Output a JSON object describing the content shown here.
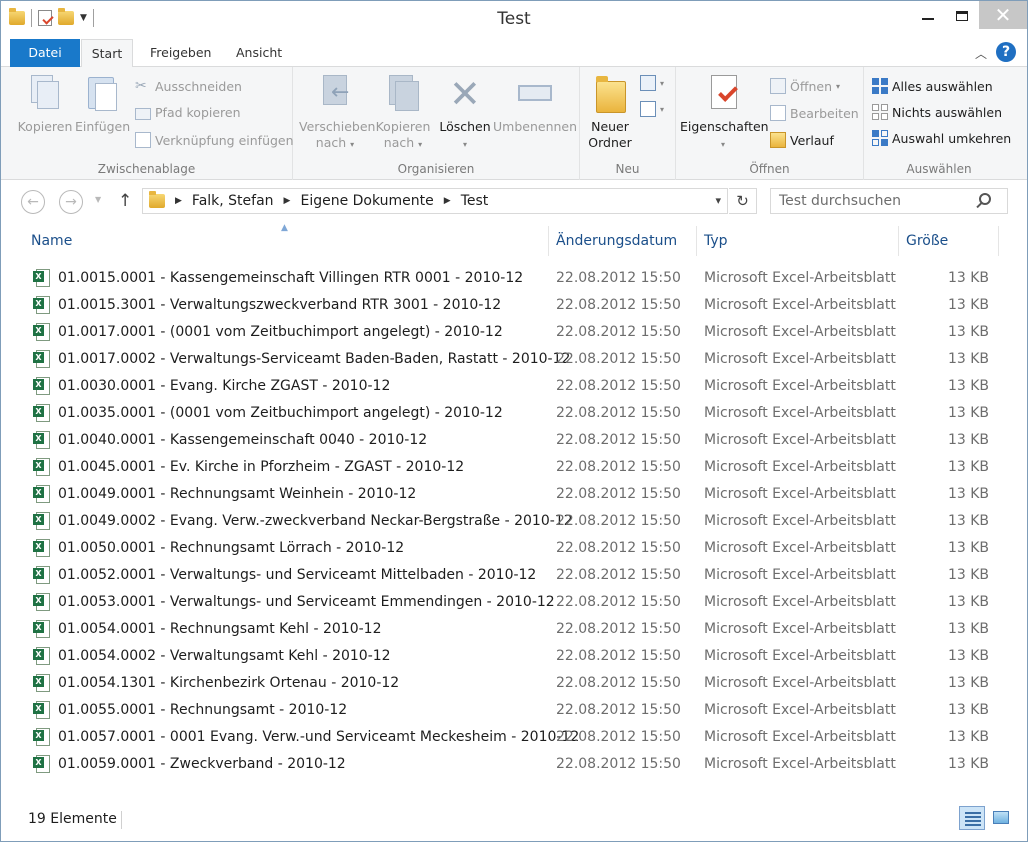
{
  "window": {
    "title": "Test"
  },
  "ribbon_tabs": [
    {
      "label": "Datei"
    },
    {
      "label": "Start"
    },
    {
      "label": "Freigeben"
    },
    {
      "label": "Ansicht"
    }
  ],
  "ribbon": {
    "clipboard": {
      "label": "Zwischenablage",
      "copy": "Kopieren",
      "paste": "Einfügen",
      "cut": "Ausschneiden",
      "copy_path": "Pfad kopieren",
      "paste_shortcut": "Verknüpfung einfügen"
    },
    "organize": {
      "label": "Organisieren",
      "move_to_1": "Verschieben",
      "move_to_2": "nach",
      "copy_to_1": "Kopieren",
      "copy_to_2": "nach",
      "delete": "Löschen",
      "rename": "Umbenennen"
    },
    "new": {
      "label": "Neu",
      "new_folder_1": "Neuer",
      "new_folder_2": "Ordner"
    },
    "open": {
      "label": "Öffnen",
      "properties": "Eigenschaften",
      "open": "Öffnen",
      "edit": "Bearbeiten",
      "history": "Verlauf"
    },
    "select": {
      "label": "Auswählen",
      "select_all": "Alles auswählen",
      "select_none": "Nichts auswählen",
      "invert": "Auswahl umkehren"
    }
  },
  "address": {
    "crumbs": [
      "Falk, Stefan",
      "Eigene Dokumente",
      "Test"
    ],
    "search_placeholder": "Test durchsuchen"
  },
  "columns": {
    "name": "Name",
    "date": "Änderungsdatum",
    "type": "Typ",
    "size": "Größe"
  },
  "files": [
    {
      "name": "01.0015.0001 - Kassengemeinschaft Villingen RTR 0001 - 2010-12",
      "date": "22.08.2012 15:50",
      "type": "Microsoft Excel-Arbeitsblatt",
      "size": "13 KB"
    },
    {
      "name": "01.0015.3001 - Verwaltungszweckverband RTR 3001 - 2010-12",
      "date": "22.08.2012 15:50",
      "type": "Microsoft Excel-Arbeitsblatt",
      "size": "13 KB"
    },
    {
      "name": "01.0017.0001 - (0001 vom Zeitbuchimport angelegt) - 2010-12",
      "date": "22.08.2012 15:50",
      "type": "Microsoft Excel-Arbeitsblatt",
      "size": "13 KB"
    },
    {
      "name": "01.0017.0002 - Verwaltungs-Serviceamt Baden-Baden, Rastatt - 2010-12",
      "date": "22.08.2012 15:50",
      "type": "Microsoft Excel-Arbeitsblatt",
      "size": "13 KB"
    },
    {
      "name": "01.0030.0001 - Evang. Kirche ZGAST - 2010-12",
      "date": "22.08.2012 15:50",
      "type": "Microsoft Excel-Arbeitsblatt",
      "size": "13 KB"
    },
    {
      "name": "01.0035.0001 - (0001 vom Zeitbuchimport angelegt) - 2010-12",
      "date": "22.08.2012 15:50",
      "type": "Microsoft Excel-Arbeitsblatt",
      "size": "13 KB"
    },
    {
      "name": "01.0040.0001 - Kassengemeinschaft 0040 - 2010-12",
      "date": "22.08.2012 15:50",
      "type": "Microsoft Excel-Arbeitsblatt",
      "size": "13 KB"
    },
    {
      "name": "01.0045.0001 - Ev. Kirche in Pforzheim - ZGAST - 2010-12",
      "date": "22.08.2012 15:50",
      "type": "Microsoft Excel-Arbeitsblatt",
      "size": "13 KB"
    },
    {
      "name": "01.0049.0001 - Rechnungsamt Weinhein - 2010-12",
      "date": "22.08.2012 15:50",
      "type": "Microsoft Excel-Arbeitsblatt",
      "size": "13 KB"
    },
    {
      "name": "01.0049.0002 - Evang. Verw.-zweckverband Neckar-Bergstraße - 2010-12",
      "date": "22.08.2012 15:50",
      "type": "Microsoft Excel-Arbeitsblatt",
      "size": "13 KB"
    },
    {
      "name": "01.0050.0001 - Rechnungsamt Lörrach - 2010-12",
      "date": "22.08.2012 15:50",
      "type": "Microsoft Excel-Arbeitsblatt",
      "size": "13 KB"
    },
    {
      "name": "01.0052.0001 - Verwaltungs- und Serviceamt Mittelbaden - 2010-12",
      "date": "22.08.2012 15:50",
      "type": "Microsoft Excel-Arbeitsblatt",
      "size": "13 KB"
    },
    {
      "name": "01.0053.0001 - Verwaltungs- und Serviceamt Emmendingen - 2010-12",
      "date": "22.08.2012 15:50",
      "type": "Microsoft Excel-Arbeitsblatt",
      "size": "13 KB"
    },
    {
      "name": "01.0054.0001 - Rechnungsamt Kehl - 2010-12",
      "date": "22.08.2012 15:50",
      "type": "Microsoft Excel-Arbeitsblatt",
      "size": "13 KB"
    },
    {
      "name": "01.0054.0002 - Verwaltungsamt Kehl - 2010-12",
      "date": "22.08.2012 15:50",
      "type": "Microsoft Excel-Arbeitsblatt",
      "size": "13 KB"
    },
    {
      "name": "01.0054.1301 - Kirchenbezirk Ortenau - 2010-12",
      "date": "22.08.2012 15:50",
      "type": "Microsoft Excel-Arbeitsblatt",
      "size": "13 KB"
    },
    {
      "name": "01.0055.0001 - Rechnungsamt - 2010-12",
      "date": "22.08.2012 15:50",
      "type": "Microsoft Excel-Arbeitsblatt",
      "size": "13 KB"
    },
    {
      "name": "01.0057.0001 - 0001 Evang. Verw.-und Serviceamt Meckesheim - 2010-12",
      "date": "22.08.2012 15:50",
      "type": "Microsoft Excel-Arbeitsblatt",
      "size": "13 KB"
    },
    {
      "name": "01.0059.0001 - Zweckverband - 2010-12",
      "date": "22.08.2012 15:50",
      "type": "Microsoft Excel-Arbeitsblatt",
      "size": "13 KB"
    }
  ],
  "status": {
    "count": "19 Elemente"
  },
  "colors": {
    "accent": "#1979ca",
    "excel_green": "#1f7244",
    "header_text": "#1b4f8a"
  }
}
